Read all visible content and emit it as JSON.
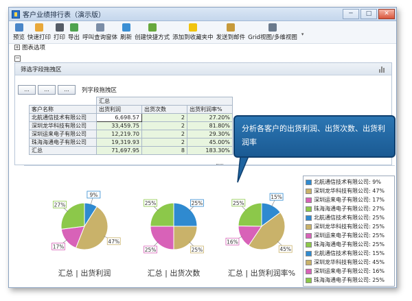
{
  "window": {
    "title": "客户业绩排行表（演示版）",
    "minimize": "─",
    "maximize": "□",
    "close": "✕"
  },
  "toolbar": {
    "items": [
      {
        "label": "预览",
        "icon": "preview-icon",
        "color": "#4a86c8"
      },
      {
        "label": "快速打印",
        "icon": "quick-print-icon",
        "color": "#e8a83a"
      },
      {
        "label": "打印",
        "icon": "print-icon",
        "color": "#555c66"
      },
      {
        "label": "导出",
        "icon": "export-icon",
        "color": "#4fa34f"
      },
      {
        "label": "呼叫查询窗体",
        "icon": "call-query-icon",
        "color": "#7b8da6"
      },
      {
        "label": "刷新",
        "icon": "refresh-icon",
        "color": "#3b8fd4"
      },
      {
        "label": "创建快捷方式",
        "icon": "shortcut-icon",
        "color": "#67a83c"
      },
      {
        "label": "添加到收藏夹中",
        "icon": "favorite-star-icon",
        "color": "#f1c40f"
      },
      {
        "label": "发送到邮件",
        "icon": "mail-icon",
        "color": "#c79a3a"
      },
      {
        "label": "Grid视图/多维视图",
        "icon": "grid-view-icon",
        "color": "#6b7a8c"
      }
    ]
  },
  "chart_options_label": "图表选项",
  "filter_bar_label": "筛选字段拖拽区",
  "pivot": {
    "buttons": [
      "...",
      "...",
      "..."
    ],
    "column_drop_label": "列字段拖拽区",
    "group_header": "汇总",
    "row_header": "客户名称",
    "columns": [
      "出货利润",
      "出货次数",
      "出货利润率%"
    ],
    "rows": [
      {
        "name": "北航通信技术有限公司",
        "values": [
          "6,698.57",
          "2",
          "27.20%"
        ]
      },
      {
        "name": "深圳龙华科技有限公司",
        "values": [
          "33,459.75",
          "2",
          "81.80%"
        ]
      },
      {
        "name": "深圳运来电子有限公司",
        "values": [
          "12,219.70",
          "2",
          "29.30%"
        ]
      },
      {
        "name": "珠海海通电子有限公司",
        "values": [
          "19,319.93",
          "2",
          "45.00%"
        ]
      },
      {
        "name": "汇总",
        "values": [
          "71,697.95",
          "8",
          "183.30%"
        ]
      }
    ]
  },
  "callout": {
    "text": "分析各客户的出货利润、出货次数、出货利润率"
  },
  "colors": {
    "blue": "#2f8ad0",
    "tan": "#c9b26a",
    "pink": "#d862b8",
    "green": "#8cc84a"
  },
  "chart_data": [
    {
      "type": "pie",
      "title": "汇总 | 出货利润",
      "series": [
        {
          "name": "北航通信技术有限公司",
          "value": 9
        },
        {
          "name": "深圳龙华科技有限公司",
          "value": 47
        },
        {
          "name": "深圳运来电子有限公司",
          "value": 17
        },
        {
          "name": "珠海海通电子有限公司",
          "value": 27
        }
      ],
      "labels": [
        "9%",
        "47%",
        "17%",
        "27%"
      ]
    },
    {
      "type": "pie",
      "title": "汇总 | 出货次数",
      "series": [
        {
          "name": "北航通信技术有限公司",
          "value": 25
        },
        {
          "name": "深圳龙华科技有限公司",
          "value": 25
        },
        {
          "name": "深圳运来电子有限公司",
          "value": 25
        },
        {
          "name": "珠海海通电子有限公司",
          "value": 25
        }
      ],
      "labels": [
        "25%",
        "25%",
        "25%",
        "25%"
      ]
    },
    {
      "type": "pie",
      "title": "汇总 | 出货利润率%",
      "series": [
        {
          "name": "北航通信技术有限公司",
          "value": 15
        },
        {
          "name": "深圳龙华科技有限公司",
          "value": 45
        },
        {
          "name": "深圳运来电子有限公司",
          "value": 16
        },
        {
          "name": "珠海海通电子有限公司",
          "value": 25
        }
      ],
      "labels": [
        "15%",
        "45%",
        "16%",
        "25%"
      ]
    }
  ],
  "legend": [
    {
      "text": "北航通信技术有限公司: 9%",
      "color": "#2f8ad0"
    },
    {
      "text": "深圳龙华科技有限公司: 47%",
      "color": "#c9b26a"
    },
    {
      "text": "深圳运来电子有限公司: 17%",
      "color": "#d862b8"
    },
    {
      "text": "珠海海通电子有限公司: 27%",
      "color": "#8cc84a"
    },
    {
      "text": "北航通信技术有限公司: 25%",
      "color": "#2f8ad0"
    },
    {
      "text": "深圳龙华科技有限公司: 25%",
      "color": "#c9b26a"
    },
    {
      "text": "深圳运来电子有限公司: 25%",
      "color": "#d862b8"
    },
    {
      "text": "珠海海通电子有限公司: 25%",
      "color": "#8cc84a"
    },
    {
      "text": "北航通信技术有限公司: 15%",
      "color": "#2f8ad0"
    },
    {
      "text": "深圳龙华科技有限公司: 45%",
      "color": "#c9b26a"
    },
    {
      "text": "深圳运来电子有限公司: 16%",
      "color": "#d862b8"
    },
    {
      "text": "珠海海通电子有限公司: 25%",
      "color": "#8cc84a"
    }
  ]
}
